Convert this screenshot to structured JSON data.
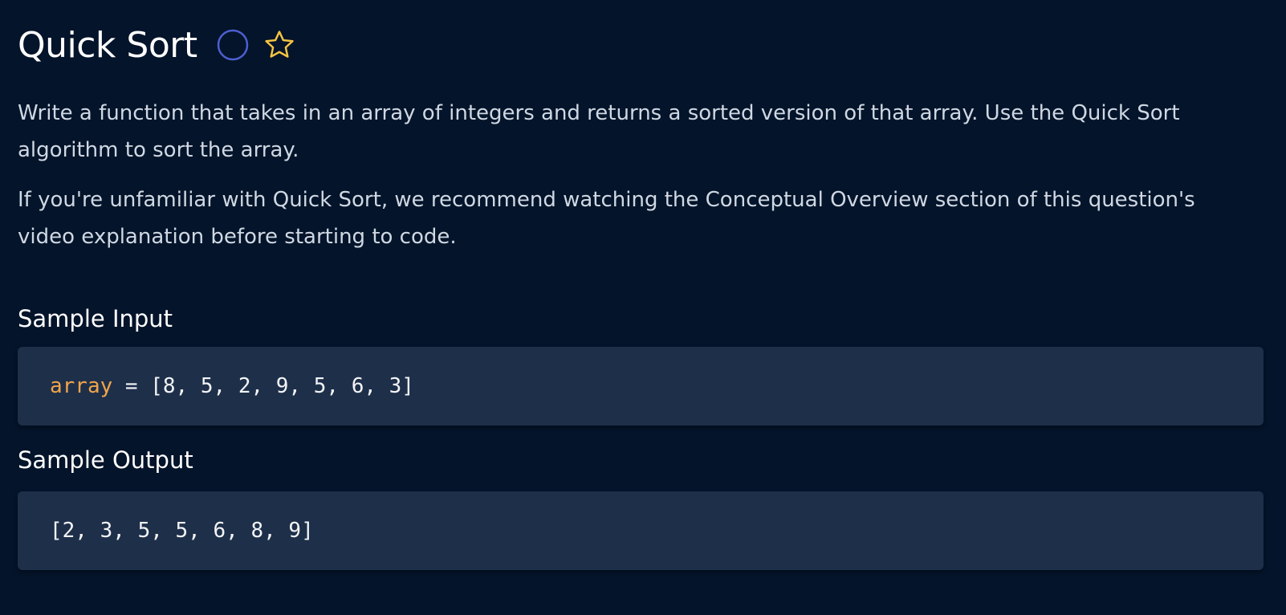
{
  "header": {
    "title": "Quick Sort",
    "status_icon": "circle-outline-icon",
    "favorite_icon": "star-outline-icon"
  },
  "description": {
    "paragraph1": "Write a function that takes in an array of integers and returns a sorted version of that array. Use the Quick Sort algorithm to sort the array.",
    "paragraph2": "If you're unfamiliar with Quick Sort, we recommend watching the Conceptual Overview section of this question's video explanation before starting to code."
  },
  "sample_input": {
    "label": "Sample Input",
    "var_name": "array",
    "assignment": " = [8, 5, 2, 9, 5, 6, 3]"
  },
  "sample_output": {
    "label": "Sample Output",
    "value": "[2, 3, 5, 5, 6, 8, 9]"
  },
  "colors": {
    "background": "#04142a",
    "code_background": "#1e2f4a",
    "accent_orange": "#f0a54a",
    "star_yellow": "#f5c542",
    "status_circle": "#4d5fd1"
  }
}
